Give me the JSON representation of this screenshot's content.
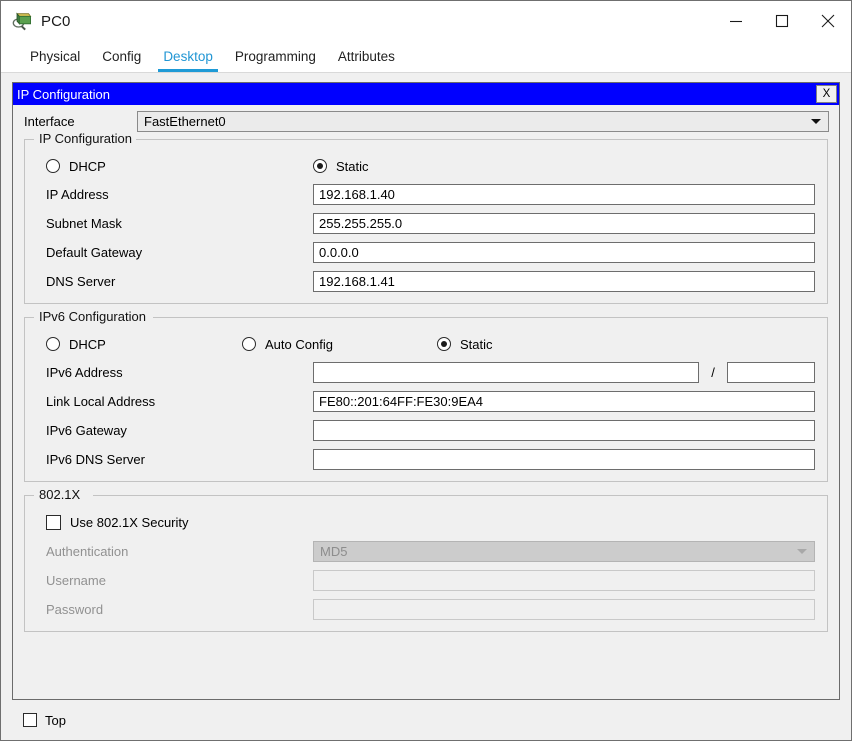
{
  "window": {
    "title": "PC0",
    "icon": "packet-tracer-device-icon",
    "controls": {
      "minimize": "–",
      "maximize": "□",
      "close": "✕"
    }
  },
  "tabs": [
    {
      "label": "Physical",
      "active": false
    },
    {
      "label": "Config",
      "active": false
    },
    {
      "label": "Desktop",
      "active": true
    },
    {
      "label": "Programming",
      "active": false
    },
    {
      "label": "Attributes",
      "active": false
    }
  ],
  "accent_color": "#1e9ad6",
  "panel": {
    "title": "IP Configuration",
    "close_label": "X",
    "interface": {
      "label": "Interface",
      "value": "FastEthernet0"
    },
    "ipv4": {
      "legend": "IP Configuration",
      "mode": {
        "dhcp_label": "DHCP",
        "dhcp_selected": false,
        "static_label": "Static",
        "static_selected": true
      },
      "fields": [
        {
          "label": "IP Address",
          "value": "192.168.1.40"
        },
        {
          "label": "Subnet Mask",
          "value": "255.255.255.0"
        },
        {
          "label": "Default Gateway",
          "value": "0.0.0.0"
        },
        {
          "label": "DNS Server",
          "value": "192.168.1.41"
        }
      ]
    },
    "ipv6": {
      "legend": "IPv6 Configuration",
      "mode": {
        "dhcp_label": "DHCP",
        "dhcp_selected": false,
        "auto_config_label": "Auto Config",
        "auto_config_selected": false,
        "static_label": "Static",
        "static_selected": true
      },
      "address": {
        "label": "IPv6 Address",
        "value": "",
        "separator": "/",
        "prefix_value": ""
      },
      "fields": [
        {
          "label": "Link Local Address",
          "value": "FE80::201:64FF:FE30:9EA4"
        },
        {
          "label": "IPv6 Gateway",
          "value": ""
        },
        {
          "label": "IPv6 DNS Server",
          "value": ""
        }
      ]
    },
    "dot1x": {
      "legend": "802.1X",
      "use_security": {
        "label": "Use 802.1X Security",
        "checked": false
      },
      "authentication": {
        "label": "Authentication",
        "value": "MD5"
      },
      "username": {
        "label": "Username",
        "value": ""
      },
      "password": {
        "label": "Password",
        "value": ""
      }
    }
  },
  "footer": {
    "top_checkbox": {
      "label": "Top",
      "checked": false
    }
  }
}
